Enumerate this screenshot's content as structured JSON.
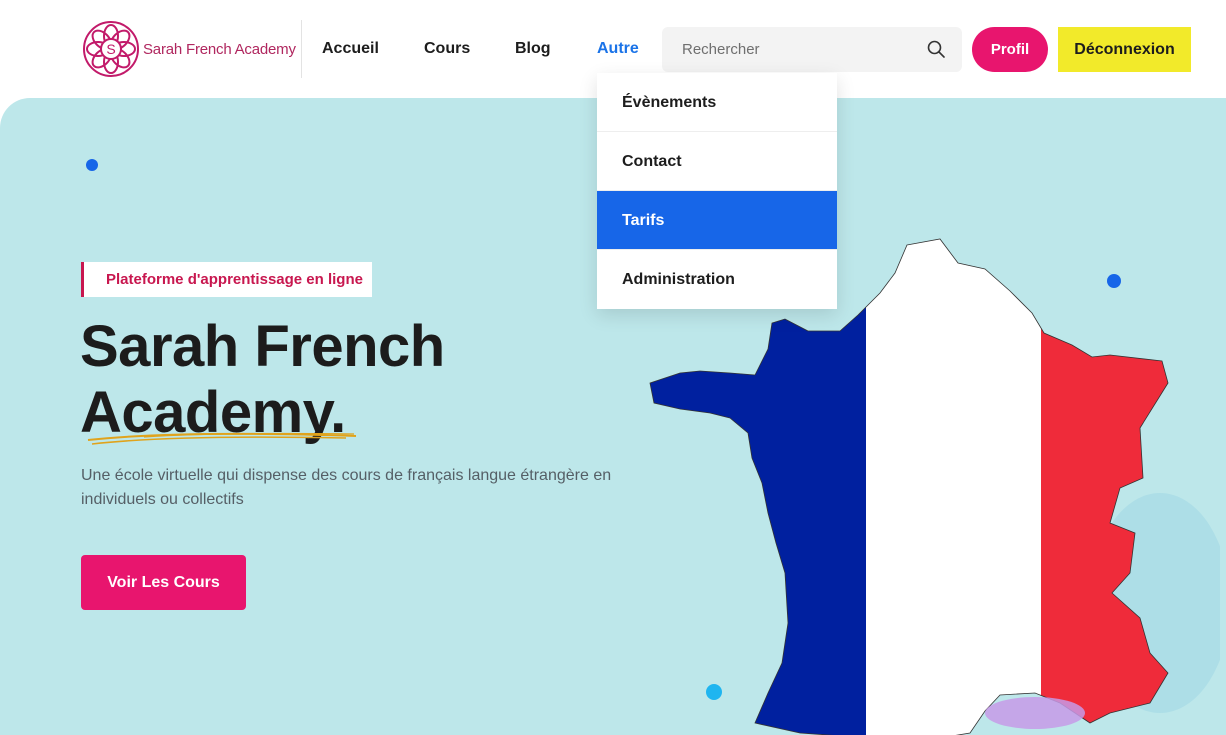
{
  "header": {
    "logo_text": "Sarah French Academy",
    "logo_letter": "S",
    "nav": {
      "accueil": "Accueil",
      "cours": "Cours",
      "blog": "Blog",
      "autre": "Autre"
    },
    "search": {
      "placeholder": "Rechercher"
    },
    "profil_label": "Profil",
    "deconnexion_label": "Déconnexion"
  },
  "dropdown": {
    "items": [
      "Évènements",
      "Contact",
      "Tarifs",
      "Administration"
    ],
    "selected": "Tarifs"
  },
  "hero": {
    "eyebrow": "Plateforme d'apprentissage en ligne",
    "title_line1": "Sarah French",
    "title_line2": "Academy.",
    "subtitle": "Une école virtuelle qui dispense des cours de français langue étrangère en individuels ou collectifs",
    "cta_label": "Voir Les Cours"
  },
  "colors": {
    "brand_pink": "#e8156e",
    "accent_yellow": "#f2ea2a",
    "link_blue": "#1a73e8",
    "hero_bg": "#bde7ea",
    "flag_blue": "#00209f",
    "flag_red": "#ef2b3a"
  },
  "icons": {
    "search": "search-icon",
    "logo": "flower-logo-icon"
  }
}
